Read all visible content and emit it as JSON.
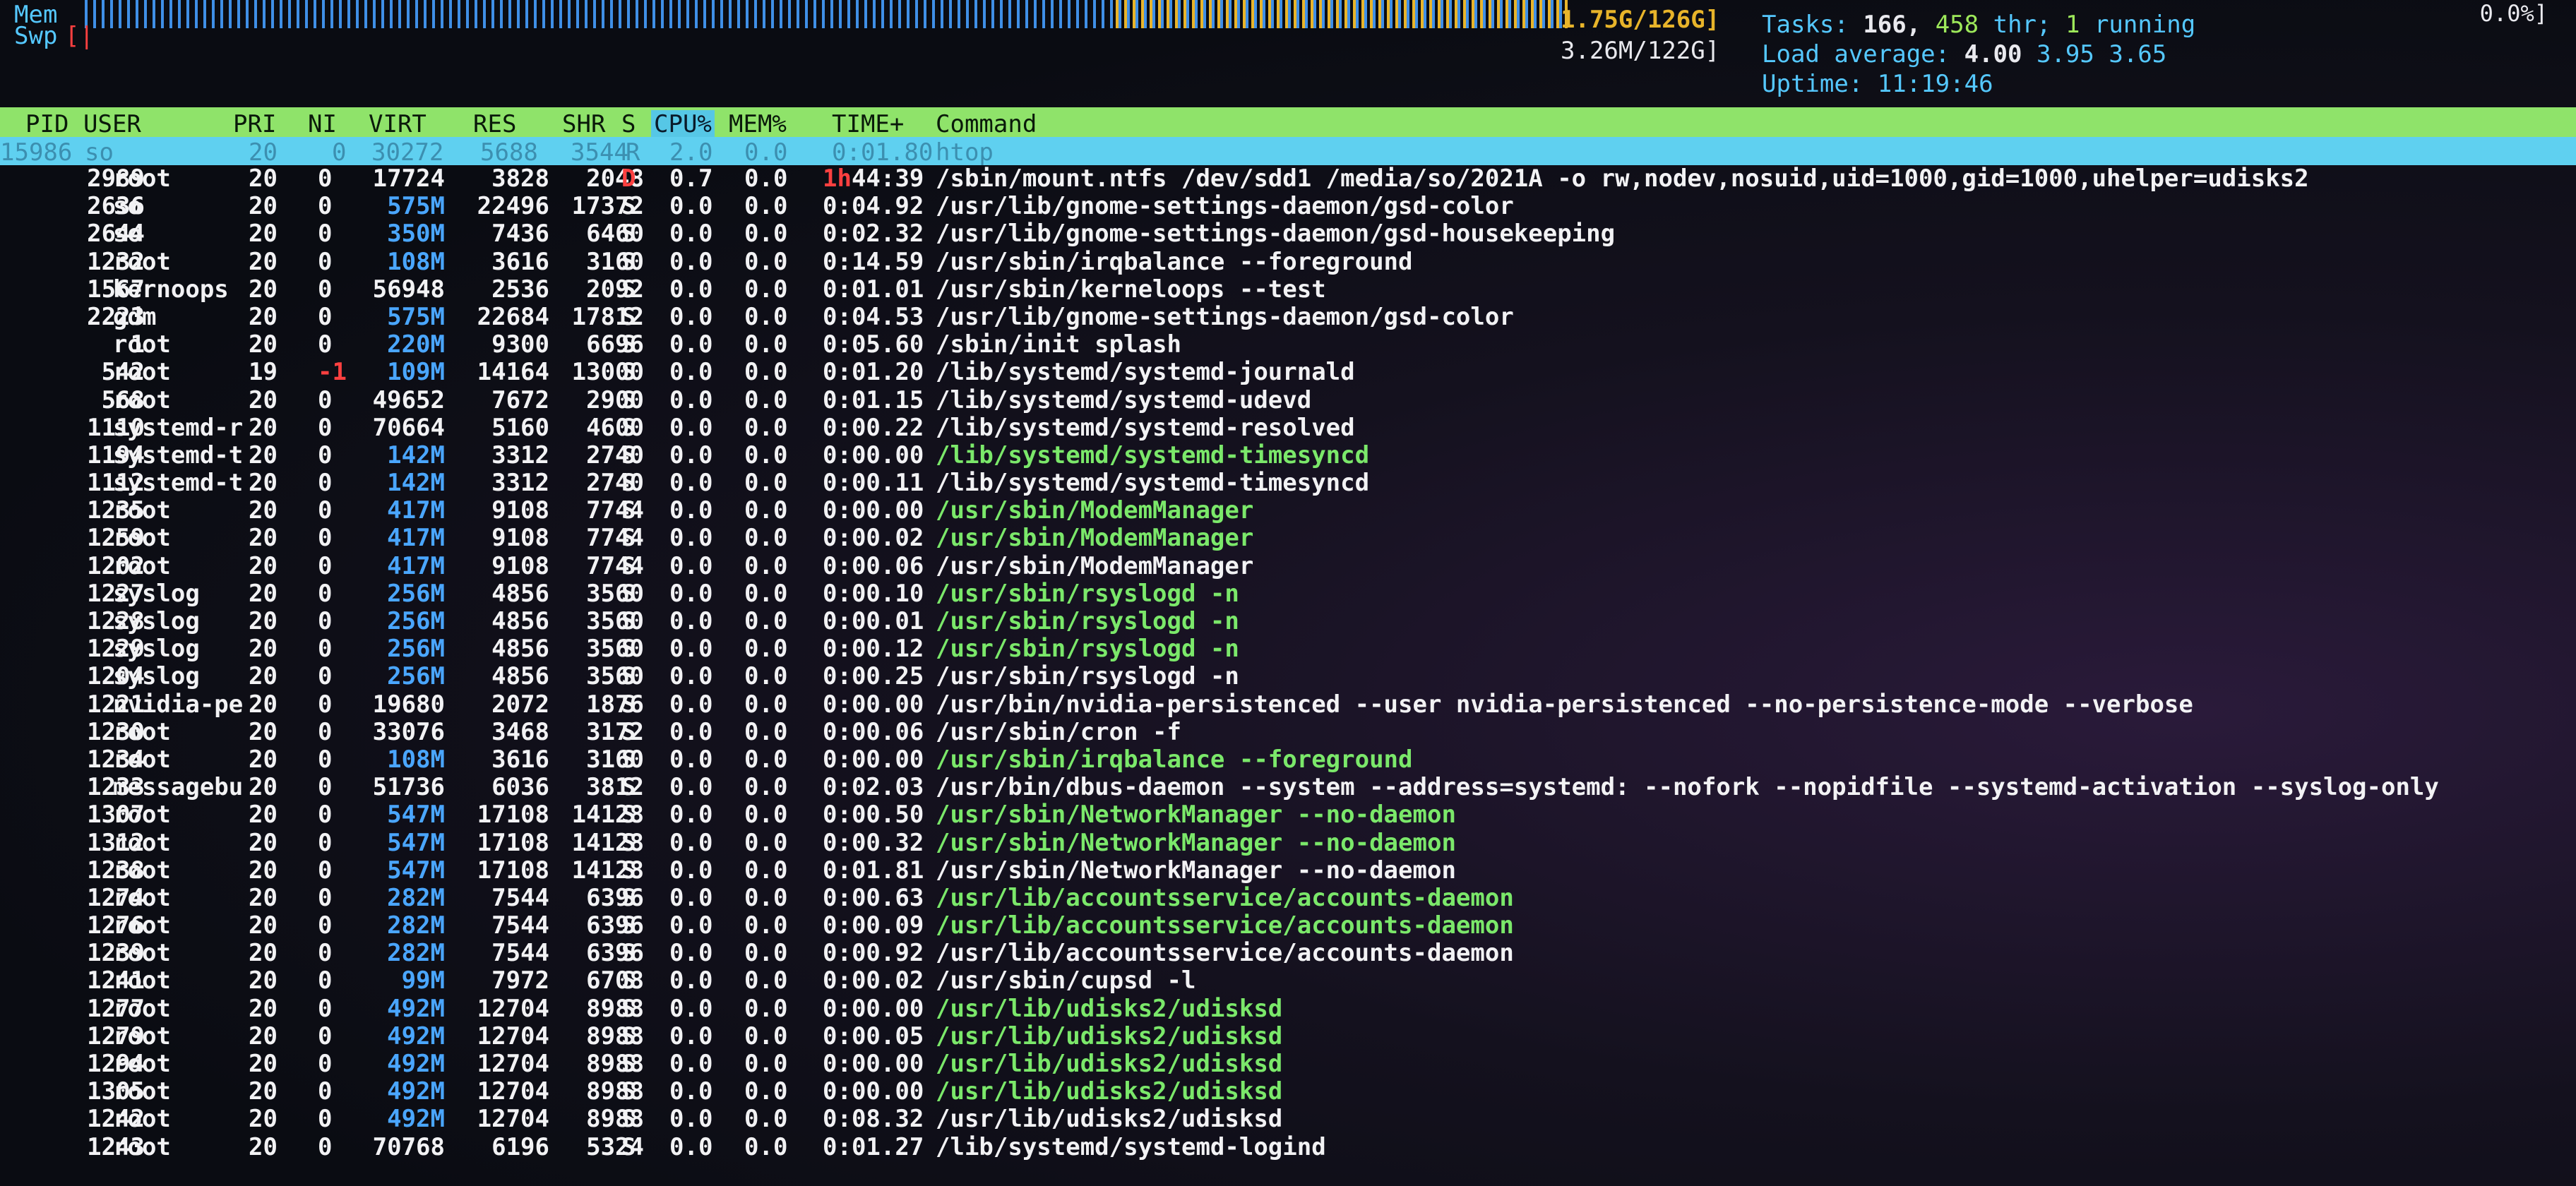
{
  "header": {
    "mem_label": "Mem",
    "swp_label": "Swp",
    "mem_used": "1.75G/126G]",
    "swp_used": "3.26M/122G]",
    "tasks_label": "Tasks:",
    "tasks_value": "166,",
    "threads_value": "458",
    "threads_label": "thr;",
    "running_value": "1",
    "running_label": "running",
    "load_label": "Load average:",
    "load_1": "4.00",
    "load_5": "3.95",
    "load_15": "3.65",
    "uptime_label": "Uptime:",
    "uptime_value": "11:19:46",
    "corner_value": "0.0%]"
  },
  "columns": {
    "pid": "PID",
    "user": "USER",
    "pri": "PRI",
    "ni": "NI",
    "virt": "VIRT",
    "res": "RES",
    "shr": "SHR",
    "s": "S",
    "cpu": "CPU%",
    "mem": "MEM%",
    "time": "TIME+",
    "command": "Command"
  },
  "selected": {
    "pid": "15986",
    "user": "so",
    "pri": "20",
    "ni": "0",
    "virt": "30272",
    "res": "5688",
    "shr": "3544",
    "s": "R",
    "cpu": "2.0",
    "mem": "0.0",
    "time": "0:01.80",
    "command": "htop"
  },
  "processes": [
    {
      "pid": "2989",
      "user": "root",
      "pri": "20",
      "ni": "0",
      "virt": "17724",
      "res": "3828",
      "shr": "2048",
      "s": "D",
      "cpu": "0.7",
      "mem": "0.0",
      "time_h": "1h",
      "time": "44:39",
      "command": "/sbin/mount.ntfs /dev/sdd1 /media/so/2021A -o rw,nodev,nosuid,uid=1000,gid=1000,uhelper=udisks2",
      "cmd_color": "white"
    },
    {
      "pid": "2636",
      "user": "so",
      "pri": "20",
      "ni": "0",
      "virt": "575M",
      "res": "22496",
      "shr": "17372",
      "s": "S",
      "cpu": "0.0",
      "mem": "0.0",
      "time": "0:04.92",
      "command": "/usr/lib/gnome-settings-daemon/gsd-color",
      "cmd_color": "white"
    },
    {
      "pid": "2644",
      "user": "so",
      "pri": "20",
      "ni": "0",
      "virt": "350M",
      "res": "7436",
      "shr": "6460",
      "s": "S",
      "cpu": "0.0",
      "mem": "0.0",
      "time": "0:02.32",
      "command": "/usr/lib/gnome-settings-daemon/gsd-housekeeping",
      "cmd_color": "white"
    },
    {
      "pid": "1232",
      "user": "root",
      "pri": "20",
      "ni": "0",
      "virt": "108M",
      "res": "3616",
      "shr": "3160",
      "s": "S",
      "cpu": "0.0",
      "mem": "0.0",
      "time": "0:14.59",
      "command": "/usr/sbin/irqbalance --foreground",
      "cmd_color": "white"
    },
    {
      "pid": "1567",
      "user": "kernoops",
      "pri": "20",
      "ni": "0",
      "virt": "56948",
      "res": "2536",
      "shr": "2092",
      "s": "S",
      "cpu": "0.0",
      "mem": "0.0",
      "time": "0:01.01",
      "command": "/usr/sbin/kerneloops --test",
      "cmd_color": "white"
    },
    {
      "pid": "2223",
      "user": "gdm",
      "pri": "20",
      "ni": "0",
      "virt": "575M",
      "res": "22684",
      "shr": "17812",
      "s": "S",
      "cpu": "0.0",
      "mem": "0.0",
      "time": "0:04.53",
      "command": "/usr/lib/gnome-settings-daemon/gsd-color",
      "cmd_color": "white"
    },
    {
      "pid": "1",
      "user": "root",
      "pri": "20",
      "ni": "0",
      "virt": "220M",
      "res": "9300",
      "shr": "6696",
      "s": "S",
      "cpu": "0.0",
      "mem": "0.0",
      "time": "0:05.60",
      "command": "/sbin/init splash",
      "cmd_color": "white"
    },
    {
      "pid": "542",
      "user": "root",
      "pri": "19",
      "ni": "-1",
      "virt": "109M",
      "res": "14164",
      "shr": "13000",
      "s": "S",
      "cpu": "0.0",
      "mem": "0.0",
      "time": "0:01.20",
      "command": "/lib/systemd/systemd-journald",
      "cmd_color": "white",
      "ni_red": true
    },
    {
      "pid": "568",
      "user": "root",
      "pri": "20",
      "ni": "0",
      "virt": "49652",
      "res": "7672",
      "shr": "2900",
      "s": "S",
      "cpu": "0.0",
      "mem": "0.0",
      "time": "0:01.15",
      "command": "/lib/systemd/systemd-udevd",
      "cmd_color": "white"
    },
    {
      "pid": "1110",
      "user": "systemd-r",
      "pri": "20",
      "ni": "0",
      "virt": "70664",
      "res": "5160",
      "shr": "4600",
      "s": "S",
      "cpu": "0.0",
      "mem": "0.0",
      "time": "0:00.22",
      "command": "/lib/systemd/systemd-resolved",
      "cmd_color": "white"
    },
    {
      "pid": "1194",
      "user": "systemd-t",
      "pri": "20",
      "ni": "0",
      "virt": "142M",
      "res": "3312",
      "shr": "2740",
      "s": "S",
      "cpu": "0.0",
      "mem": "0.0",
      "time": "0:00.00",
      "command": "/lib/systemd/systemd-timesyncd",
      "cmd_color": "green"
    },
    {
      "pid": "1112",
      "user": "systemd-t",
      "pri": "20",
      "ni": "0",
      "virt": "142M",
      "res": "3312",
      "shr": "2740",
      "s": "S",
      "cpu": "0.0",
      "mem": "0.0",
      "time": "0:00.11",
      "command": "/lib/systemd/systemd-timesyncd",
      "cmd_color": "white"
    },
    {
      "pid": "1235",
      "user": "root",
      "pri": "20",
      "ni": "0",
      "virt": "417M",
      "res": "9108",
      "shr": "7744",
      "s": "S",
      "cpu": "0.0",
      "mem": "0.0",
      "time": "0:00.00",
      "command": "/usr/sbin/ModemManager",
      "cmd_color": "green"
    },
    {
      "pid": "1259",
      "user": "root",
      "pri": "20",
      "ni": "0",
      "virt": "417M",
      "res": "9108",
      "shr": "7744",
      "s": "S",
      "cpu": "0.0",
      "mem": "0.0",
      "time": "0:00.02",
      "command": "/usr/sbin/ModemManager",
      "cmd_color": "green"
    },
    {
      "pid": "1202",
      "user": "root",
      "pri": "20",
      "ni": "0",
      "virt": "417M",
      "res": "9108",
      "shr": "7744",
      "s": "S",
      "cpu": "0.0",
      "mem": "0.0",
      "time": "0:00.06",
      "command": "/usr/sbin/ModemManager",
      "cmd_color": "white"
    },
    {
      "pid": "1227",
      "user": "syslog",
      "pri": "20",
      "ni": "0",
      "virt": "256M",
      "res": "4856",
      "shr": "3560",
      "s": "S",
      "cpu": "0.0",
      "mem": "0.0",
      "time": "0:00.10",
      "command": "/usr/sbin/rsyslogd -n",
      "cmd_color": "green"
    },
    {
      "pid": "1228",
      "user": "syslog",
      "pri": "20",
      "ni": "0",
      "virt": "256M",
      "res": "4856",
      "shr": "3560",
      "s": "S",
      "cpu": "0.0",
      "mem": "0.0",
      "time": "0:00.01",
      "command": "/usr/sbin/rsyslogd -n",
      "cmd_color": "green"
    },
    {
      "pid": "1229",
      "user": "syslog",
      "pri": "20",
      "ni": "0",
      "virt": "256M",
      "res": "4856",
      "shr": "3560",
      "s": "S",
      "cpu": "0.0",
      "mem": "0.0",
      "time": "0:00.12",
      "command": "/usr/sbin/rsyslogd -n",
      "cmd_color": "green"
    },
    {
      "pid": "1204",
      "user": "syslog",
      "pri": "20",
      "ni": "0",
      "virt": "256M",
      "res": "4856",
      "shr": "3560",
      "s": "S",
      "cpu": "0.0",
      "mem": "0.0",
      "time": "0:00.25",
      "command": "/usr/sbin/rsyslogd -n",
      "cmd_color": "white"
    },
    {
      "pid": "1221",
      "user": "nvidia-pe",
      "pri": "20",
      "ni": "0",
      "virt": "19680",
      "res": "2072",
      "shr": "1876",
      "s": "S",
      "cpu": "0.0",
      "mem": "0.0",
      "time": "0:00.00",
      "command": "/usr/bin/nvidia-persistenced --user nvidia-persistenced --no-persistence-mode --verbose",
      "cmd_color": "white"
    },
    {
      "pid": "1230",
      "user": "root",
      "pri": "20",
      "ni": "0",
      "virt": "33076",
      "res": "3468",
      "shr": "3172",
      "s": "S",
      "cpu": "0.0",
      "mem": "0.0",
      "time": "0:00.06",
      "command": "/usr/sbin/cron -f",
      "cmd_color": "white"
    },
    {
      "pid": "1234",
      "user": "root",
      "pri": "20",
      "ni": "0",
      "virt": "108M",
      "res": "3616",
      "shr": "3160",
      "s": "S",
      "cpu": "0.0",
      "mem": "0.0",
      "time": "0:00.00",
      "command": "/usr/sbin/irqbalance --foreground",
      "cmd_color": "green"
    },
    {
      "pid": "1233",
      "user": "messagebu",
      "pri": "20",
      "ni": "0",
      "virt": "51736",
      "res": "6036",
      "shr": "3812",
      "s": "S",
      "cpu": "0.0",
      "mem": "0.0",
      "time": "0:02.03",
      "command": "/usr/bin/dbus-daemon --system --address=systemd: --nofork --nopidfile --systemd-activation --syslog-only",
      "cmd_color": "white"
    },
    {
      "pid": "1307",
      "user": "root",
      "pri": "20",
      "ni": "0",
      "virt": "547M",
      "res": "17108",
      "shr": "14128",
      "s": "S",
      "cpu": "0.0",
      "mem": "0.0",
      "time": "0:00.50",
      "command": "/usr/sbin/NetworkManager --no-daemon",
      "cmd_color": "green"
    },
    {
      "pid": "1312",
      "user": "root",
      "pri": "20",
      "ni": "0",
      "virt": "547M",
      "res": "17108",
      "shr": "14128",
      "s": "S",
      "cpu": "0.0",
      "mem": "0.0",
      "time": "0:00.32",
      "command": "/usr/sbin/NetworkManager --no-daemon",
      "cmd_color": "green"
    },
    {
      "pid": "1238",
      "user": "root",
      "pri": "20",
      "ni": "0",
      "virt": "547M",
      "res": "17108",
      "shr": "14128",
      "s": "S",
      "cpu": "0.0",
      "mem": "0.0",
      "time": "0:01.81",
      "command": "/usr/sbin/NetworkManager --no-daemon",
      "cmd_color": "white"
    },
    {
      "pid": "1274",
      "user": "root",
      "pri": "20",
      "ni": "0",
      "virt": "282M",
      "res": "7544",
      "shr": "6396",
      "s": "S",
      "cpu": "0.0",
      "mem": "0.0",
      "time": "0:00.63",
      "command": "/usr/lib/accountsservice/accounts-daemon",
      "cmd_color": "green"
    },
    {
      "pid": "1276",
      "user": "root",
      "pri": "20",
      "ni": "0",
      "virt": "282M",
      "res": "7544",
      "shr": "6396",
      "s": "S",
      "cpu": "0.0",
      "mem": "0.0",
      "time": "0:00.09",
      "command": "/usr/lib/accountsservice/accounts-daemon",
      "cmd_color": "green"
    },
    {
      "pid": "1239",
      "user": "root",
      "pri": "20",
      "ni": "0",
      "virt": "282M",
      "res": "7544",
      "shr": "6396",
      "s": "S",
      "cpu": "0.0",
      "mem": "0.0",
      "time": "0:00.92",
      "command": "/usr/lib/accountsservice/accounts-daemon",
      "cmd_color": "white"
    },
    {
      "pid": "1241",
      "user": "root",
      "pri": "20",
      "ni": "0",
      "virt": "99M",
      "res": "7972",
      "shr": "6708",
      "s": "S",
      "cpu": "0.0",
      "mem": "0.0",
      "time": "0:00.02",
      "command": "/usr/sbin/cupsd -l",
      "cmd_color": "white"
    },
    {
      "pid": "1277",
      "user": "root",
      "pri": "20",
      "ni": "0",
      "virt": "492M",
      "res": "12704",
      "shr": "8988",
      "s": "S",
      "cpu": "0.0",
      "mem": "0.0",
      "time": "0:00.00",
      "command": "/usr/lib/udisks2/udisksd",
      "cmd_color": "green"
    },
    {
      "pid": "1279",
      "user": "root",
      "pri": "20",
      "ni": "0",
      "virt": "492M",
      "res": "12704",
      "shr": "8988",
      "s": "S",
      "cpu": "0.0",
      "mem": "0.0",
      "time": "0:00.05",
      "command": "/usr/lib/udisks2/udisksd",
      "cmd_color": "green"
    },
    {
      "pid": "1294",
      "user": "root",
      "pri": "20",
      "ni": "0",
      "virt": "492M",
      "res": "12704",
      "shr": "8988",
      "s": "S",
      "cpu": "0.0",
      "mem": "0.0",
      "time": "0:00.00",
      "command": "/usr/lib/udisks2/udisksd",
      "cmd_color": "green"
    },
    {
      "pid": "1305",
      "user": "root",
      "pri": "20",
      "ni": "0",
      "virt": "492M",
      "res": "12704",
      "shr": "8988",
      "s": "S",
      "cpu": "0.0",
      "mem": "0.0",
      "time": "0:00.00",
      "command": "/usr/lib/udisks2/udisksd",
      "cmd_color": "green"
    },
    {
      "pid": "1242",
      "user": "root",
      "pri": "20",
      "ni": "0",
      "virt": "492M",
      "res": "12704",
      "shr": "8988",
      "s": "S",
      "cpu": "0.0",
      "mem": "0.0",
      "time": "0:08.32",
      "command": "/usr/lib/udisks2/udisksd",
      "cmd_color": "white"
    },
    {
      "pid": "1243",
      "user": "root",
      "pri": "20",
      "ni": "0",
      "virt": "70768",
      "res": "6196",
      "shr": "5324",
      "s": "S",
      "cpu": "0.0",
      "mem": "0.0",
      "time": "0:01.27",
      "command": "/lib/systemd/systemd-logind",
      "cmd_color": "white"
    }
  ],
  "colors": {
    "header_bg": "#8fe36a",
    "selected_bg": "#5fd0f0",
    "cpu_header_bg": "#56c7e6",
    "meter_blue": "#3f8fe6",
    "meter_yellow": "#e8b42a",
    "cmd_green": "#7be86a",
    "virt_blue": "#4aa6ff",
    "alert_red": "#ff4040"
  }
}
